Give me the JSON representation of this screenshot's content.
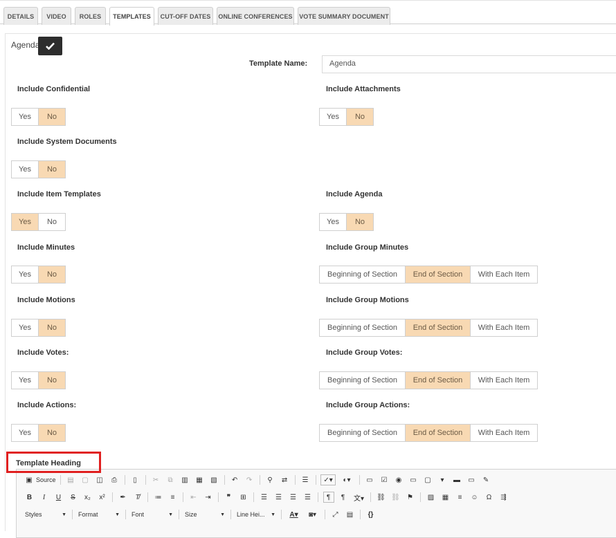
{
  "tabs": [
    {
      "label": "DETAILS",
      "active": false
    },
    {
      "label": "VIDEO",
      "active": false
    },
    {
      "label": "ROLES",
      "active": false
    },
    {
      "label": "TEMPLATES",
      "active": true
    },
    {
      "label": "CUT-OFF DATES",
      "active": false
    },
    {
      "label": "ONLINE CONFERENCES",
      "active": false
    },
    {
      "label": "VOTE SUMMARY DOCUMENT",
      "active": false
    }
  ],
  "template_title": "Agenda",
  "template_name_label": "Template Name:",
  "template_name_value": "Agenda",
  "fields": {
    "include_confidential": {
      "label": "Include Confidential",
      "options": [
        "Yes",
        "No"
      ],
      "selected": "No"
    },
    "include_attachments": {
      "label": "Include Attachments",
      "options": [
        "Yes",
        "No"
      ],
      "selected": "No"
    },
    "include_system_documents": {
      "label": "Include System Documents",
      "options": [
        "Yes",
        "No"
      ],
      "selected": "No"
    },
    "include_item_templates": {
      "label": "Include Item Templates",
      "options": [
        "Yes",
        "No"
      ],
      "selected": "Yes"
    },
    "include_agenda": {
      "label": "Include Agenda",
      "options": [
        "Yes",
        "No"
      ],
      "selected": "No"
    },
    "include_minutes": {
      "label": "Include Minutes",
      "options": [
        "Yes",
        "No"
      ],
      "selected": "No"
    },
    "include_group_minutes": {
      "label": "Include Group Minutes",
      "options": [
        "Beginning of Section",
        "End of Section",
        "With Each Item"
      ],
      "selected": "End of Section"
    },
    "include_motions": {
      "label": "Include Motions",
      "options": [
        "Yes",
        "No"
      ],
      "selected": "No"
    },
    "include_group_motions": {
      "label": "Include Group Motions",
      "options": [
        "Beginning of Section",
        "End of Section",
        "With Each Item"
      ],
      "selected": "End of Section"
    },
    "include_votes": {
      "label": "Include Votes:",
      "options": [
        "Yes",
        "No"
      ],
      "selected": "No"
    },
    "include_group_votes": {
      "label": "Include Group Votes:",
      "options": [
        "Beginning of Section",
        "End of Section",
        "With Each Item"
      ],
      "selected": "End of Section"
    },
    "include_actions": {
      "label": "Include Actions:",
      "options": [
        "Yes",
        "No"
      ],
      "selected": "No"
    },
    "include_group_actions": {
      "label": "Include Group Actions:",
      "options": [
        "Beginning of Section",
        "End of Section",
        "With Each Item"
      ],
      "selected": "End of Section"
    }
  },
  "template_heading_label": "Template Heading",
  "editor": {
    "source_label": "Source",
    "combos": [
      {
        "label": "Styles"
      },
      {
        "label": "Format"
      },
      {
        "label": "Font"
      },
      {
        "label": "Size"
      },
      {
        "label": "Line Hei..."
      }
    ]
  },
  "colors": {
    "selected_option": "#f8d9b3",
    "check_button": "#2d2d2d",
    "highlight_box": "#e02020"
  }
}
